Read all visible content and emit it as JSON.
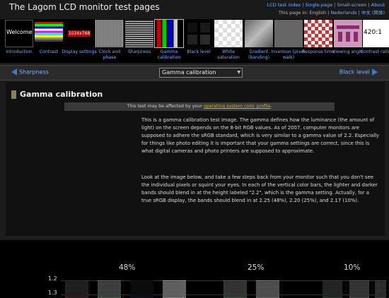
{
  "site": {
    "title": "The Lagom LCD monitor test pages",
    "links": [
      "LCD test index",
      "Single-page",
      "Small-screen",
      "About"
    ],
    "lang_prefix": "This page in: English |",
    "lang_links": "Nederlands | 中文 (简体)"
  },
  "thumbs": [
    {
      "id": "introduction",
      "label": "Introduction"
    },
    {
      "id": "contrast",
      "label": "Contrast"
    },
    {
      "id": "display-settings",
      "label": "Display settings",
      "img_text": "1024x768"
    },
    {
      "id": "clock-phase",
      "label": "Clock and phase"
    },
    {
      "id": "sharpness",
      "label": "Sharpness"
    },
    {
      "id": "gamma-calibration",
      "label": "Gamma calibration"
    },
    {
      "id": "black-level",
      "label": "Black level"
    },
    {
      "id": "white-saturation",
      "label": "White saturation"
    },
    {
      "id": "gradient",
      "label": "Gradient (banding)"
    },
    {
      "id": "inversion",
      "label": "Inversion (pixel-walk)"
    },
    {
      "id": "response-time",
      "label": "Response time"
    },
    {
      "id": "viewing-angle",
      "label": "Viewing angle"
    },
    {
      "id": "contrast-ratio",
      "label": "Contrast ratio",
      "img_text": "420:1"
    }
  ],
  "thumb_welcome": "Welcome",
  "nav": {
    "prev": "Sharpness",
    "current": "Gamma calibration",
    "next": "Black level"
  },
  "main": {
    "heading": "Gamma calibration",
    "notice_prefix": "This test may be affected by your ",
    "notice_link": "operating system color profile",
    "notice_suffix": ".",
    "para1": "This is a gamma calibration test image. The gamma defines how the luminance (the amount of light) on the screen depends on the 8-bit RGB values. As of 2007, computer monitors are supposed to adhere the sRGB standard, which is very similar to a gamma value of 2.2. Especially for things like photo editing it is important that your gamma settings are correct, since this is what digital cameras and photo printers are supposed to approximate.",
    "para2": "Look at the image below, and take a few steps back from your monitor such that you don't see the individual pixels or squint your eyes. In each of the vertical color bars, the lighter and darker bands should blend in at the height labeled \"2.2\", which is the gamma setting. Actually, for a true sRGB display, the bands should blend in at 2.25 (48%), 2.20 (25%), and 2.17 (10%)."
  },
  "pattern": {
    "groups": [
      "48%",
      "25%",
      "10%"
    ],
    "gamma_labels": [
      "1.2",
      "1.3"
    ]
  },
  "colors": {
    "link": "#7fb0ff",
    "nav_arrow": "#3a78c9",
    "notice_link": "#e0b000",
    "heading_mark": "#8a8160"
  }
}
